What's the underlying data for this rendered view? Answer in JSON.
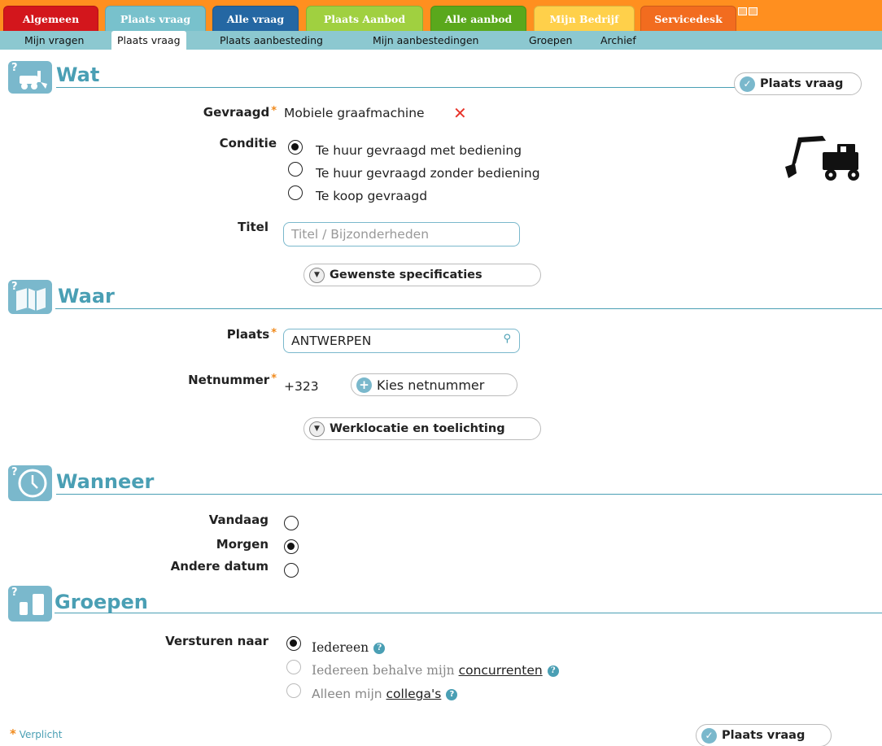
{
  "tabs": [
    {
      "label": "Algemeen",
      "color": "#d3161c"
    },
    {
      "label": "Plaats vraag",
      "color": "#78c1cc"
    },
    {
      "label": "Alle vraag",
      "color": "#2467a3"
    },
    {
      "label": "Plaats Aanbod",
      "color": "#a0d040"
    },
    {
      "label": "Alle aanbod",
      "color": "#5aa81c"
    },
    {
      "label": "Mijn Bedrijf",
      "color": "#ffd04a"
    },
    {
      "label": "Servicedesk",
      "color": "#f26c1f"
    }
  ],
  "subnav": [
    "Mijn vragen",
    "Plaats vraag",
    "Plaats aanbesteding",
    "Mijn aanbestedingen",
    "Groepen",
    "Archief"
  ],
  "sections": {
    "wat": "Wat",
    "waar": "Waar",
    "wanneer": "Wanneer",
    "groepen": "Groepen"
  },
  "submit_label": "Plaats vraag",
  "wat": {
    "gevraagd_label": "Gevraagd",
    "gevraagd_value": "Mobiele graafmachine",
    "conditie_label": "Conditie",
    "conditie_options": [
      "Te huur gevraagd met bediening",
      "Te huur gevraagd zonder bediening",
      "Te koop gevraagd"
    ],
    "titel_label": "Titel",
    "titel_placeholder": "Titel / Bijzonderheden",
    "specs_label": "Gewenste specificaties"
  },
  "waar": {
    "plaats_label": "Plaats",
    "plaats_value": "ANTWERPEN",
    "netnummer_label": "Netnummer",
    "netnummer_value": "+323",
    "kies_label": "Kies netnummer",
    "werklocatie_label": "Werklocatie en toelichting"
  },
  "wanneer": {
    "options": [
      "Vandaag",
      "Morgen",
      "Andere datum"
    ]
  },
  "groepen": {
    "versturen_label": "Versturen naar",
    "opt1": "Iedereen",
    "opt2_prefix": "Iedereen behalve mijn",
    "opt2_link": "concurrenten",
    "opt3_prefix": "Alleen mijn",
    "opt3_link": "collega's"
  },
  "footer": {
    "required_note": "Verplicht"
  },
  "icons": {
    "remove": "remove-x-icon",
    "search": "search-icon",
    "help": "help-icon",
    "check": "check-icon",
    "chevron": "chevron-down-icon"
  }
}
